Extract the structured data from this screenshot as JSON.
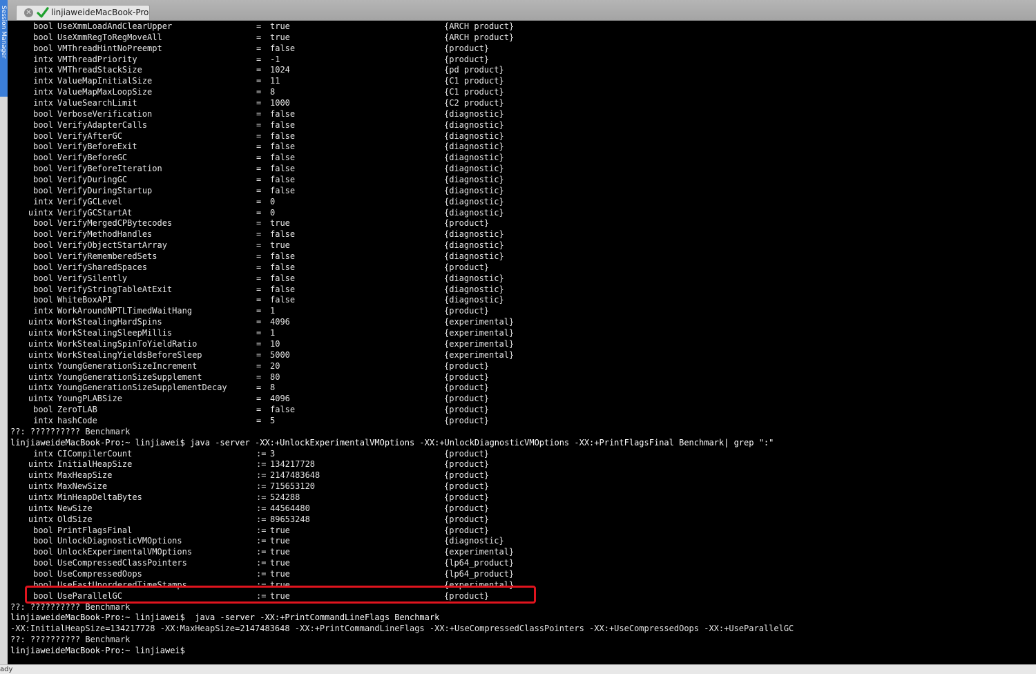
{
  "side_strip": {
    "label": "Session Manager"
  },
  "tab": {
    "title": "linjiaweideMacBook-Pro"
  },
  "terminal": {
    "flags_part1": [
      [
        "bool",
        "UseXmmLoadAndClearUpper",
        "=",
        "true",
        "{ARCH product}"
      ],
      [
        "bool",
        "UseXmmRegToRegMoveAll",
        "=",
        "true",
        "{ARCH product}"
      ],
      [
        "bool",
        "VMThreadHintNoPreempt",
        "=",
        "false",
        "{product}"
      ],
      [
        "intx",
        "VMThreadPriority",
        "=",
        "-1",
        "{product}"
      ],
      [
        "intx",
        "VMThreadStackSize",
        "=",
        "1024",
        "{pd product}"
      ],
      [
        "intx",
        "ValueMapInitialSize",
        "=",
        "11",
        "{C1 product}"
      ],
      [
        "intx",
        "ValueMapMaxLoopSize",
        "=",
        "8",
        "{C1 product}"
      ],
      [
        "intx",
        "ValueSearchLimit",
        "=",
        "1000",
        "{C2 product}"
      ],
      [
        "bool",
        "VerboseVerification",
        "=",
        "false",
        "{diagnostic}"
      ],
      [
        "bool",
        "VerifyAdapterCalls",
        "=",
        "false",
        "{diagnostic}"
      ],
      [
        "bool",
        "VerifyAfterGC",
        "=",
        "false",
        "{diagnostic}"
      ],
      [
        "bool",
        "VerifyBeforeExit",
        "=",
        "false",
        "{diagnostic}"
      ],
      [
        "bool",
        "VerifyBeforeGC",
        "=",
        "false",
        "{diagnostic}"
      ],
      [
        "bool",
        "VerifyBeforeIteration",
        "=",
        "false",
        "{diagnostic}"
      ],
      [
        "bool",
        "VerifyDuringGC",
        "=",
        "false",
        "{diagnostic}"
      ],
      [
        "bool",
        "VerifyDuringStartup",
        "=",
        "false",
        "{diagnostic}"
      ],
      [
        "intx",
        "VerifyGCLevel",
        "=",
        "0",
        "{diagnostic}"
      ],
      [
        "uintx",
        "VerifyGCStartAt",
        "=",
        "0",
        "{diagnostic}"
      ],
      [
        "bool",
        "VerifyMergedCPBytecodes",
        "=",
        "true",
        "{product}"
      ],
      [
        "bool",
        "VerifyMethodHandles",
        "=",
        "false",
        "{diagnostic}"
      ],
      [
        "bool",
        "VerifyObjectStartArray",
        "=",
        "true",
        "{diagnostic}"
      ],
      [
        "bool",
        "VerifyRememberedSets",
        "=",
        "false",
        "{diagnostic}"
      ],
      [
        "bool",
        "VerifySharedSpaces",
        "=",
        "false",
        "{product}"
      ],
      [
        "bool",
        "VerifySilently",
        "=",
        "false",
        "{diagnostic}"
      ],
      [
        "bool",
        "VerifyStringTableAtExit",
        "=",
        "false",
        "{diagnostic}"
      ],
      [
        "bool",
        "WhiteBoxAPI",
        "=",
        "false",
        "{diagnostic}"
      ],
      [
        "intx",
        "WorkAroundNPTLTimedWaitHang",
        "=",
        "1",
        "{product}"
      ],
      [
        "uintx",
        "WorkStealingHardSpins",
        "=",
        "4096",
        "{experimental}"
      ],
      [
        "uintx",
        "WorkStealingSleepMillis",
        "=",
        "1",
        "{experimental}"
      ],
      [
        "uintx",
        "WorkStealingSpinToYieldRatio",
        "=",
        "10",
        "{experimental}"
      ],
      [
        "uintx",
        "WorkStealingYieldsBeforeSleep",
        "=",
        "5000",
        "{experimental}"
      ],
      [
        "uintx",
        "YoungGenerationSizeIncrement",
        "=",
        "20",
        "{product}"
      ],
      [
        "uintx",
        "YoungGenerationSizeSupplement",
        "=",
        "80",
        "{product}"
      ],
      [
        "uintx",
        "YoungGenerationSizeSupplementDecay",
        "=",
        "8",
        "{product}"
      ],
      [
        "uintx",
        "YoungPLABSize",
        "=",
        "4096",
        "{product}"
      ],
      [
        "bool",
        "ZeroTLAB",
        "=",
        "false",
        "{product}"
      ],
      [
        "intx",
        "hashCode",
        "=",
        "5",
        "{product}"
      ]
    ],
    "line_benchmark_1": "??: ?????????? Benchmark",
    "cmd_1": "linjiaweideMacBook-Pro:~ linjiawei$ java -server -XX:+UnlockExperimentalVMOptions -XX:+UnlockDiagnosticVMOptions -XX:+PrintFlagsFinal Benchmark| grep \":\"",
    "flags_part2": [
      [
        "intx",
        "CICompilerCount",
        ":=",
        "3",
        "{product}"
      ],
      [
        "uintx",
        "InitialHeapSize",
        ":=",
        "134217728",
        "{product}"
      ],
      [
        "uintx",
        "MaxHeapSize",
        ":=",
        "2147483648",
        "{product}"
      ],
      [
        "uintx",
        "MaxNewSize",
        ":=",
        "715653120",
        "{product}"
      ],
      [
        "uintx",
        "MinHeapDeltaBytes",
        ":=",
        "524288",
        "{product}"
      ],
      [
        "uintx",
        "NewSize",
        ":=",
        "44564480",
        "{product}"
      ],
      [
        "uintx",
        "OldSize",
        ":=",
        "89653248",
        "{product}"
      ],
      [
        "bool",
        "PrintFlagsFinal",
        ":=",
        "true",
        "{product}"
      ],
      [
        "bool",
        "UnlockDiagnosticVMOptions",
        ":=",
        "true",
        "{diagnostic}"
      ],
      [
        "bool",
        "UnlockExperimentalVMOptions",
        ":=",
        "true",
        "{experimental}"
      ],
      [
        "bool",
        "UseCompressedClassPointers",
        ":=",
        "true",
        "{lp64_product}"
      ],
      [
        "bool",
        "UseCompressedOops",
        ":=",
        "true",
        "{lp64_product}"
      ],
      [
        "bool",
        "UseFastUnorderedTimeStamps",
        ":=",
        "true",
        "{experimental}"
      ],
      [
        "bool",
        "UseParallelGC",
        ":=",
        "true",
        "{product}"
      ]
    ],
    "line_benchmark_2": "??: ?????????? Benchmark",
    "cmd_2": "linjiaweideMacBook-Pro:~ linjiawei$  java -server -XX:+PrintCommandLineFlags Benchmark",
    "output_flags": "-XX:InitialHeapSize=134217728 -XX:MaxHeapSize=2147483648 -XX:+PrintCommandLineFlags -XX:+UseCompressedClassPointers -XX:+UseCompressedOops -XX:+UseParallelGC",
    "line_benchmark_3": "??: ?????????? Benchmark",
    "prompt": "linjiaweideMacBook-Pro:~ linjiawei$"
  },
  "status": {
    "text": "ady"
  },
  "colors": {
    "highlight": "#e0141e",
    "tab_check": "#1fa12e",
    "side_strip": "#3b7ed8"
  }
}
